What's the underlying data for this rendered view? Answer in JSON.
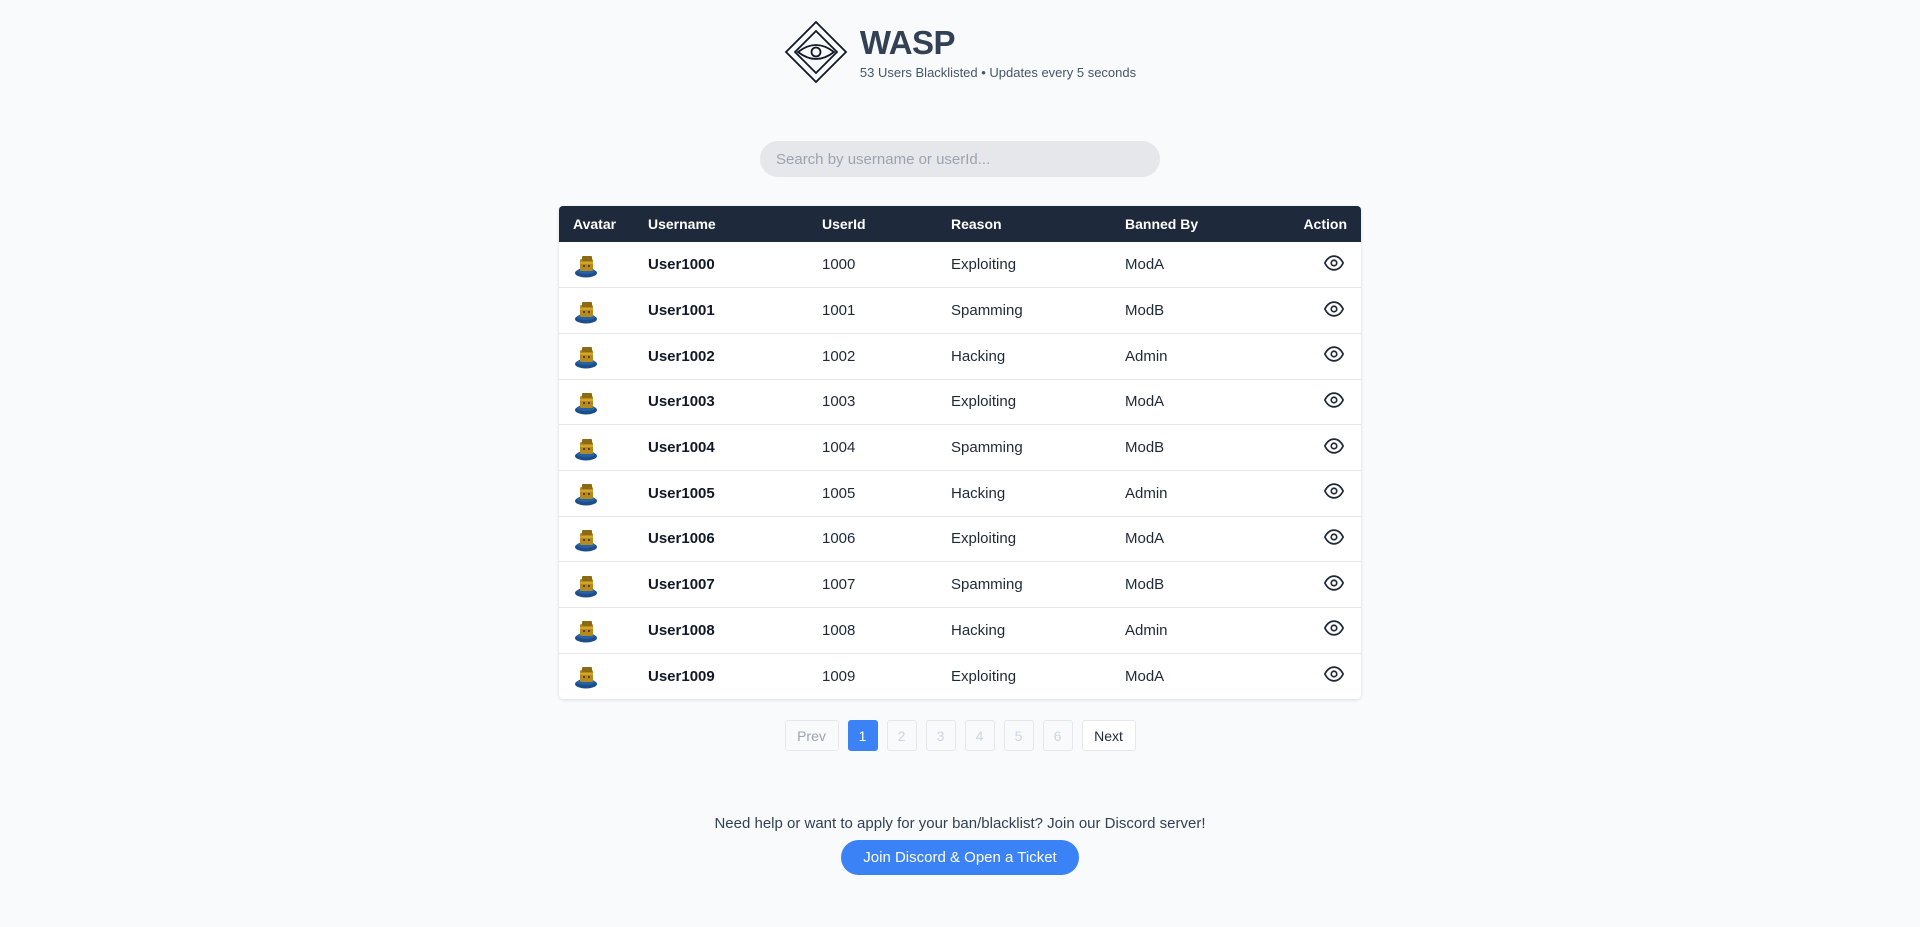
{
  "header": {
    "title": "WASP",
    "subtitle": "53 Users Blacklisted • Updates every 5 seconds",
    "logo_icon": "diamond-eye-logo"
  },
  "search": {
    "placeholder": "Search by username or userId...",
    "value": ""
  },
  "table": {
    "columns": [
      "Avatar",
      "Username",
      "UserId",
      "Reason",
      "Banned By",
      "Action"
    ],
    "rows": [
      {
        "username": "User1000",
        "userid": "1000",
        "reason": "Exploiting",
        "banned_by": "ModA"
      },
      {
        "username": "User1001",
        "userid": "1001",
        "reason": "Spamming",
        "banned_by": "ModB"
      },
      {
        "username": "User1002",
        "userid": "1002",
        "reason": "Hacking",
        "banned_by": "Admin"
      },
      {
        "username": "User1003",
        "userid": "1003",
        "reason": "Exploiting",
        "banned_by": "ModA"
      },
      {
        "username": "User1004",
        "userid": "1004",
        "reason": "Spamming",
        "banned_by": "ModB"
      },
      {
        "username": "User1005",
        "userid": "1005",
        "reason": "Hacking",
        "banned_by": "Admin"
      },
      {
        "username": "User1006",
        "userid": "1006",
        "reason": "Exploiting",
        "banned_by": "ModA"
      },
      {
        "username": "User1007",
        "userid": "1007",
        "reason": "Spamming",
        "banned_by": "ModB"
      },
      {
        "username": "User1008",
        "userid": "1008",
        "reason": "Hacking",
        "banned_by": "Admin"
      },
      {
        "username": "User1009",
        "userid": "1009",
        "reason": "Exploiting",
        "banned_by": "ModA"
      }
    ],
    "action_icon": "eye-icon"
  },
  "pagination": {
    "prev_label": "Prev",
    "pages": [
      "1",
      "2",
      "3",
      "4",
      "5",
      "6"
    ],
    "current_page": "1",
    "next_label": "Next"
  },
  "footer": {
    "help_text": "Need help or want to apply for your ban/blacklist? Join our Discord server!",
    "discord_button_label": "Join Discord & Open a Ticket"
  },
  "colors": {
    "header_bg": "#1e293b",
    "accent": "#3b82f6",
    "page_bg": "#f8fafc"
  }
}
